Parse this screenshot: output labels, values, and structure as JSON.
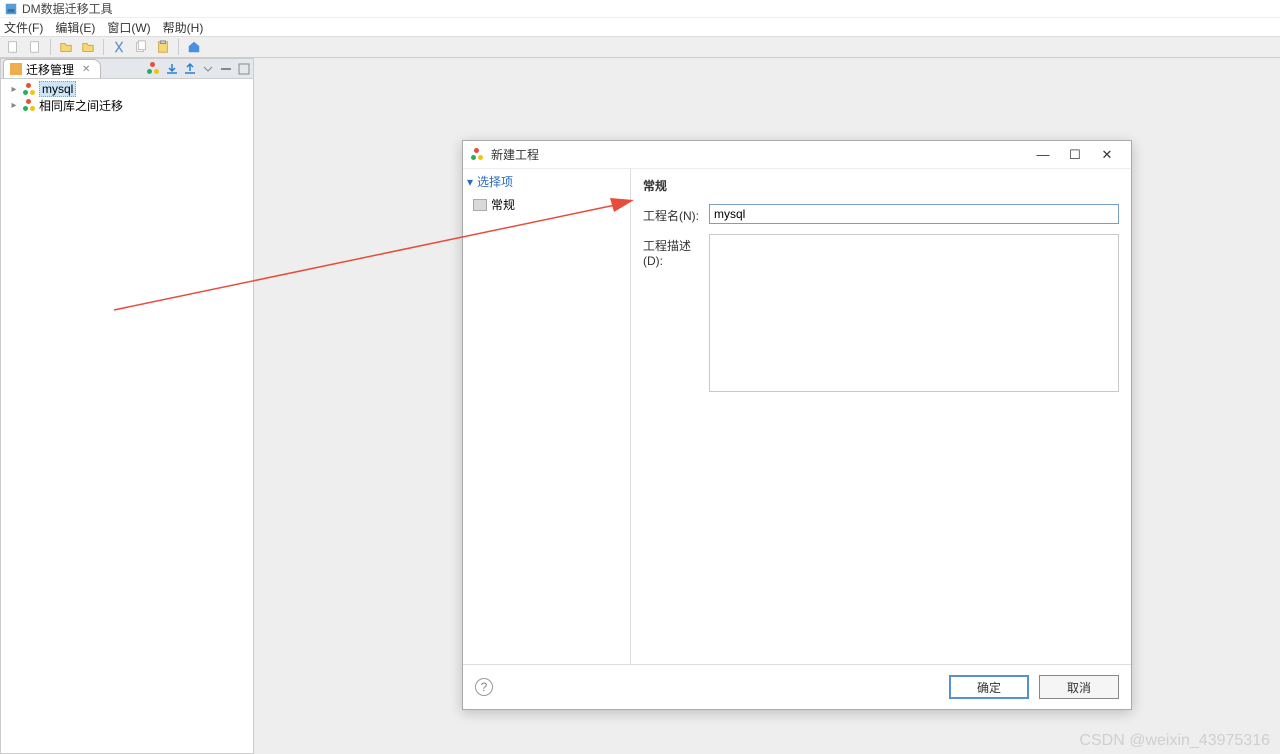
{
  "app": {
    "title": "DM数据迁移工具"
  },
  "menu": {
    "file": "文件(F)",
    "edit": "编辑(E)",
    "window": "窗口(W)",
    "help": "帮助(H)"
  },
  "panel": {
    "tab_label": "迁移管理",
    "tree": {
      "item0": "mysql",
      "item1": "相同库之间迁移"
    }
  },
  "dialog": {
    "title": "新建工程",
    "nav_group": "选择项",
    "nav_item": "常规",
    "form_title": "常规",
    "name_label": "工程名(N):",
    "name_value": "mysql",
    "desc_label": "工程描述(D):",
    "desc_value": "",
    "btn_ok": "确定",
    "btn_cancel": "取消"
  },
  "watermark": "CSDN @weixin_43975316"
}
